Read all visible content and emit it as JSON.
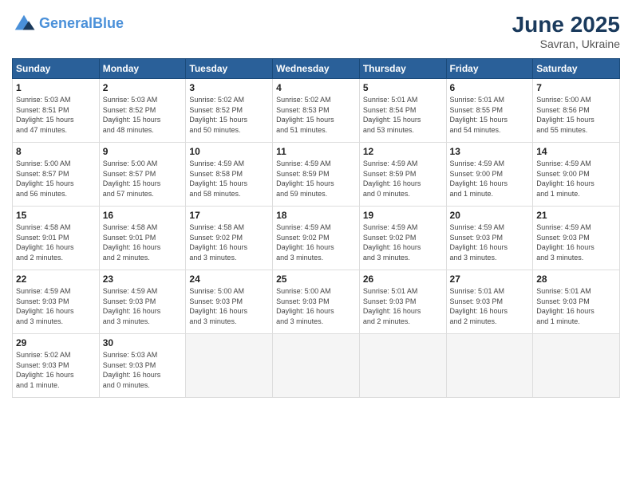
{
  "header": {
    "logo_line1": "General",
    "logo_line2": "Blue",
    "month_year": "June 2025",
    "location": "Savran, Ukraine"
  },
  "weekdays": [
    "Sunday",
    "Monday",
    "Tuesday",
    "Wednesday",
    "Thursday",
    "Friday",
    "Saturday"
  ],
  "weeks": [
    [
      {
        "day": "1",
        "info": "Sunrise: 5:03 AM\nSunset: 8:51 PM\nDaylight: 15 hours\nand 47 minutes."
      },
      {
        "day": "2",
        "info": "Sunrise: 5:03 AM\nSunset: 8:52 PM\nDaylight: 15 hours\nand 48 minutes."
      },
      {
        "day": "3",
        "info": "Sunrise: 5:02 AM\nSunset: 8:52 PM\nDaylight: 15 hours\nand 50 minutes."
      },
      {
        "day": "4",
        "info": "Sunrise: 5:02 AM\nSunset: 8:53 PM\nDaylight: 15 hours\nand 51 minutes."
      },
      {
        "day": "5",
        "info": "Sunrise: 5:01 AM\nSunset: 8:54 PM\nDaylight: 15 hours\nand 53 minutes."
      },
      {
        "day": "6",
        "info": "Sunrise: 5:01 AM\nSunset: 8:55 PM\nDaylight: 15 hours\nand 54 minutes."
      },
      {
        "day": "7",
        "info": "Sunrise: 5:00 AM\nSunset: 8:56 PM\nDaylight: 15 hours\nand 55 minutes."
      }
    ],
    [
      {
        "day": "8",
        "info": "Sunrise: 5:00 AM\nSunset: 8:57 PM\nDaylight: 15 hours\nand 56 minutes."
      },
      {
        "day": "9",
        "info": "Sunrise: 5:00 AM\nSunset: 8:57 PM\nDaylight: 15 hours\nand 57 minutes."
      },
      {
        "day": "10",
        "info": "Sunrise: 4:59 AM\nSunset: 8:58 PM\nDaylight: 15 hours\nand 58 minutes."
      },
      {
        "day": "11",
        "info": "Sunrise: 4:59 AM\nSunset: 8:59 PM\nDaylight: 15 hours\nand 59 minutes."
      },
      {
        "day": "12",
        "info": "Sunrise: 4:59 AM\nSunset: 8:59 PM\nDaylight: 16 hours\nand 0 minutes."
      },
      {
        "day": "13",
        "info": "Sunrise: 4:59 AM\nSunset: 9:00 PM\nDaylight: 16 hours\nand 1 minute."
      },
      {
        "day": "14",
        "info": "Sunrise: 4:59 AM\nSunset: 9:00 PM\nDaylight: 16 hours\nand 1 minute."
      }
    ],
    [
      {
        "day": "15",
        "info": "Sunrise: 4:58 AM\nSunset: 9:01 PM\nDaylight: 16 hours\nand 2 minutes."
      },
      {
        "day": "16",
        "info": "Sunrise: 4:58 AM\nSunset: 9:01 PM\nDaylight: 16 hours\nand 2 minutes."
      },
      {
        "day": "17",
        "info": "Sunrise: 4:58 AM\nSunset: 9:02 PM\nDaylight: 16 hours\nand 3 minutes."
      },
      {
        "day": "18",
        "info": "Sunrise: 4:59 AM\nSunset: 9:02 PM\nDaylight: 16 hours\nand 3 minutes."
      },
      {
        "day": "19",
        "info": "Sunrise: 4:59 AM\nSunset: 9:02 PM\nDaylight: 16 hours\nand 3 minutes."
      },
      {
        "day": "20",
        "info": "Sunrise: 4:59 AM\nSunset: 9:03 PM\nDaylight: 16 hours\nand 3 minutes."
      },
      {
        "day": "21",
        "info": "Sunrise: 4:59 AM\nSunset: 9:03 PM\nDaylight: 16 hours\nand 3 minutes."
      }
    ],
    [
      {
        "day": "22",
        "info": "Sunrise: 4:59 AM\nSunset: 9:03 PM\nDaylight: 16 hours\nand 3 minutes."
      },
      {
        "day": "23",
        "info": "Sunrise: 4:59 AM\nSunset: 9:03 PM\nDaylight: 16 hours\nand 3 minutes."
      },
      {
        "day": "24",
        "info": "Sunrise: 5:00 AM\nSunset: 9:03 PM\nDaylight: 16 hours\nand 3 minutes."
      },
      {
        "day": "25",
        "info": "Sunrise: 5:00 AM\nSunset: 9:03 PM\nDaylight: 16 hours\nand 3 minutes."
      },
      {
        "day": "26",
        "info": "Sunrise: 5:01 AM\nSunset: 9:03 PM\nDaylight: 16 hours\nand 2 minutes."
      },
      {
        "day": "27",
        "info": "Sunrise: 5:01 AM\nSunset: 9:03 PM\nDaylight: 16 hours\nand 2 minutes."
      },
      {
        "day": "28",
        "info": "Sunrise: 5:01 AM\nSunset: 9:03 PM\nDaylight: 16 hours\nand 1 minute."
      }
    ],
    [
      {
        "day": "29",
        "info": "Sunrise: 5:02 AM\nSunset: 9:03 PM\nDaylight: 16 hours\nand 1 minute."
      },
      {
        "day": "30",
        "info": "Sunrise: 5:03 AM\nSunset: 9:03 PM\nDaylight: 16 hours\nand 0 minutes."
      },
      {
        "day": "",
        "info": ""
      },
      {
        "day": "",
        "info": ""
      },
      {
        "day": "",
        "info": ""
      },
      {
        "day": "",
        "info": ""
      },
      {
        "day": "",
        "info": ""
      }
    ]
  ]
}
